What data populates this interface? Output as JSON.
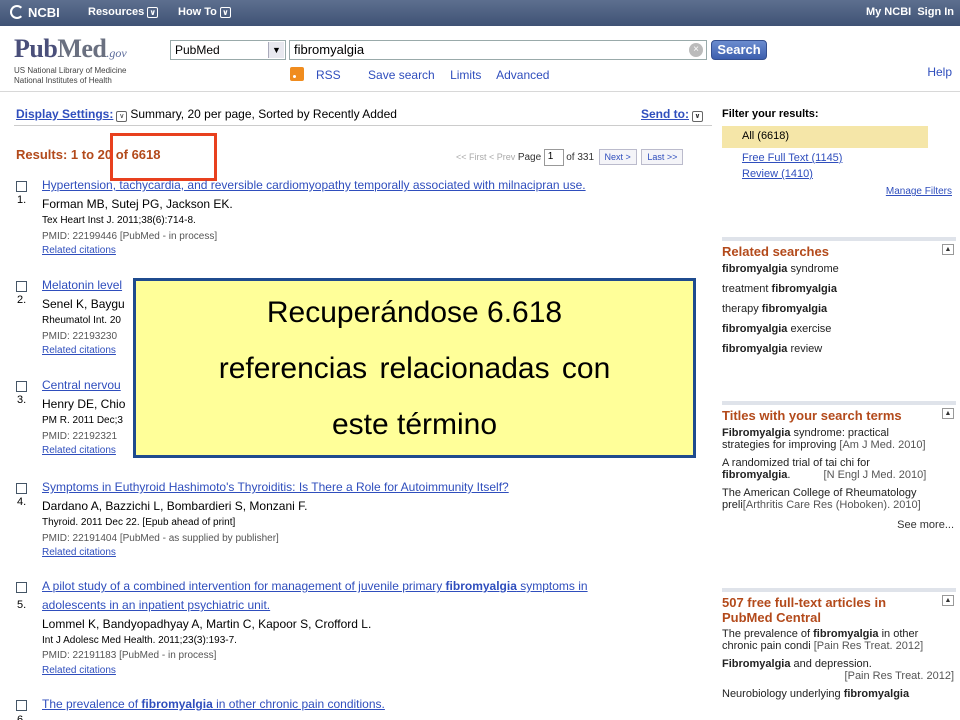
{
  "topbar": {
    "brand": "NCBI",
    "resources": "Resources",
    "howto": "How To",
    "mylink": "My NCBI",
    "signin": "Sign In"
  },
  "header": {
    "logo_pub": "Pub",
    "logo_med": "Med",
    "logo_gov": ".gov",
    "sub1": "US National Library of Medicine",
    "sub2": "National Institutes of Health",
    "database": "PubMed",
    "query": "fibromyalgia",
    "search_label": "Search",
    "links": [
      "RSS",
      "Save search",
      "Limits",
      "Advanced"
    ],
    "help": "Help"
  },
  "display": {
    "label": "Display Settings:",
    "value": "Summary, 20 per page, Sorted by Recently Added",
    "send_to": "Send to:"
  },
  "results_count": "Results: 1 to 20 of 6618",
  "pager": {
    "first": "<< First",
    "prev": "< Prev",
    "page_label": "Page",
    "page": "1",
    "of": "of 331",
    "next": "Next >",
    "last": "Last >>"
  },
  "results": [
    {
      "num": "1.",
      "title": "Hypertension, tachycardia, and reversible cardiomyopathy temporally associated with milnacipran use.",
      "authors": "Forman MB, Sutej PG, Jackson EK.",
      "journal": "Tex Heart Inst J. 2011;38(6):714-8.",
      "pmid": "PMID: 22199446 [PubMed - in process]",
      "related": "Related citations"
    },
    {
      "num": "2.",
      "title": "Melatonin level",
      "authors": "Senel K, Baygu",
      "journal": "Rheumatol Int. 20",
      "pmid": "PMID: 22193230",
      "related": "Related citations"
    },
    {
      "num": "3.",
      "title": "Central nervou",
      "authors": "Henry DE, Chio",
      "journal": "PM R. 2011 Dec;3",
      "pmid": "PMID: 22192321",
      "related": "Related citations"
    },
    {
      "num": "4.",
      "title": "Symptoms in Euthyroid Hashimoto's Thyroiditis: Is There a Role for Autoimmunity Itself?",
      "authors": "Dardano A, Bazzichi L, Bombardieri S, Monzani F.",
      "journal": "Thyroid. 2011 Dec 22. [Epub ahead of print]",
      "pmid": "PMID: 22191404 [PubMed - as supplied by publisher]",
      "related": "Related citations"
    },
    {
      "num": "5.",
      "title_a": "A pilot study of a combined intervention for management of juvenile primary ",
      "title_hl": "fibromyalgia",
      "title_b": " symptoms in",
      "title_line2": "adolescents in an inpatient psychiatric unit.",
      "authors": "Lommel K, Bandyopadhyay A, Martin C, Kapoor S, Crofford L.",
      "journal": "Int J Adolesc Med Health. 2011;23(3):193-7.",
      "pmid": "PMID: 22191183 [PubMed - in process]",
      "related": "Related citations"
    },
    {
      "num": "6.",
      "title_a": "The prevalence of ",
      "title_hl": "fibromyalgia",
      "title_b": " in other chronic pain conditions."
    }
  ],
  "sidebar": {
    "filter_head": "Filter your results:",
    "filters": [
      "All (6618)",
      "Free Full Text (1145)",
      "Review (1410)"
    ],
    "manage": "Manage Filters",
    "related_head": "Related searches",
    "related": [
      {
        "pre": "",
        "hl": "fibromyalgia",
        "post": " syndrome"
      },
      {
        "pre": "treatment ",
        "hl": "fibromyalgia",
        "post": ""
      },
      {
        "pre": "therapy ",
        "hl": "fibromyalgia",
        "post": ""
      },
      {
        "pre": "",
        "hl": "fibromyalgia",
        "post": " exercise"
      },
      {
        "pre": "",
        "hl": "fibromyalgia",
        "post": " review"
      }
    ],
    "titles_head": "Titles with your search terms",
    "titles": [
      {
        "l1_hl": "Fibromyalgia",
        "l1": " syndrome: practical",
        "l2": "strategies for improving",
        "src": "[Am J Med. 2010]"
      },
      {
        "l1": "A randomized trial of tai chi for",
        "l2_hl": "fibromyalgia",
        "l2": ".",
        "src": "[N Engl J Med. 2010]"
      },
      {
        "l1": "The American College of Rheumatology",
        "l2": "preli",
        "src": "[Arthritis Care Res (Hoboken). 2010]"
      }
    ],
    "see_more": "See more...",
    "pmc_head1": "507 free full-text articles in",
    "pmc_head2": "PubMed Central",
    "pmc": [
      {
        "l1": "The prevalence of ",
        "l1_hl": "fibromyalgia",
        "l1b": " in other",
        "l2": "chronic pain condi",
        "src": "[Pain Res Treat. 2012]"
      },
      {
        "l1_hl0": "Fibromyalgia",
        "l1": " and depression.",
        "src": "[Pain Res Treat. 2012]"
      },
      {
        "l1": "Neurobiology underlying ",
        "l1_hl": "fibromyalgia"
      }
    ]
  },
  "overlay": {
    "line1": "Recuperándose 6.618",
    "line2": "referencias relacionadas con",
    "line3": "este término"
  }
}
